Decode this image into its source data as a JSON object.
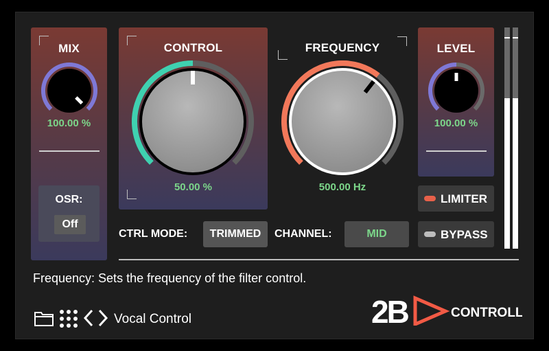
{
  "mix": {
    "title": "MIX",
    "value": "100.00 %",
    "level": 1.0
  },
  "control": {
    "title": "CONTROL",
    "value": "50.00 %",
    "level": 0.5
  },
  "frequency": {
    "title": "FREQUENCY",
    "value": "500.00 Hz",
    "level": 0.64
  },
  "level": {
    "title": "LEVEL",
    "value": "100.00 %",
    "level": 0.5
  },
  "osr": {
    "label": "OSR:",
    "value": "Off"
  },
  "ctrl_mode": {
    "label": "CTRL MODE:",
    "value": "TRIMMED"
  },
  "channel": {
    "label": "CHANNEL:",
    "value": "MID"
  },
  "limiter": {
    "label": "LIMITER",
    "led_color": "#e8614a"
  },
  "bypass": {
    "label": "BYPASS",
    "led_color": "#bdbdbd"
  },
  "description": "Frequency: Sets the frequency of the filter control.",
  "footer": {
    "preset_name": "Vocal Control"
  },
  "brand": {
    "mark": "2B",
    "word": "CONTROLLED"
  },
  "colors": {
    "accent_teal": "#3fd1b0",
    "accent_orange": "#f2785a",
    "accent_purple": "#7f78d6",
    "value_green": "#7cd68a"
  },
  "meters": [
    {
      "level": 0.68
    },
    {
      "level": 0.68
    }
  ]
}
